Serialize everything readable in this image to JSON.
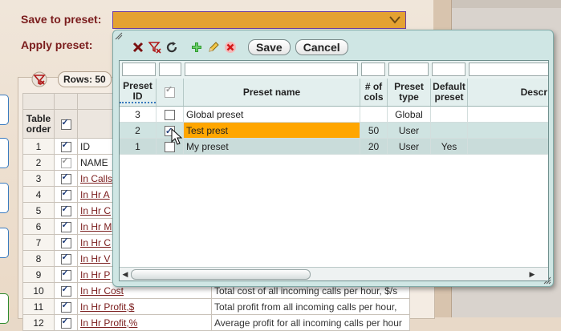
{
  "background": {
    "save_to_preset_label": "Save to preset:",
    "apply_preset_label": "Apply preset:",
    "rows_button_label": "Rows: 50",
    "table": {
      "header": {
        "order": "Table order"
      },
      "rows": [
        {
          "order": "1",
          "checked": true,
          "name": "ID",
          "link": false,
          "desc": ""
        },
        {
          "order": "2",
          "checked": true,
          "disabled": true,
          "name": "NAME",
          "link": false,
          "desc": ""
        },
        {
          "order": "3",
          "checked": true,
          "name": "In Calls",
          "link": true,
          "desc": ""
        },
        {
          "order": "4",
          "checked": true,
          "name": "In Hr A",
          "link": true,
          "desc": ""
        },
        {
          "order": "5",
          "checked": true,
          "name": "In Hr C",
          "link": true,
          "desc": ""
        },
        {
          "order": "6",
          "checked": true,
          "name": "In Hr M",
          "link": true,
          "desc": ""
        },
        {
          "order": "7",
          "checked": true,
          "name": "In Hr C",
          "link": true,
          "desc": ""
        },
        {
          "order": "8",
          "checked": true,
          "name": "In Hr V",
          "link": true,
          "desc": ""
        },
        {
          "order": "9",
          "checked": true,
          "name": "In Hr P",
          "link": true,
          "desc": ""
        },
        {
          "order": "10",
          "checked": true,
          "name": "In Hr Cost",
          "link": true,
          "desc": "Total cost of all incoming calls per hour, $/s"
        },
        {
          "order": "11",
          "checked": true,
          "name": "In Hr Profit,$",
          "link": true,
          "desc": "Total profit from all incoming calls per hour,"
        },
        {
          "order": "12",
          "checked": true,
          "name": "In Hr Profit,%",
          "link": true,
          "desc": "Average profit for all incoming calls per hour"
        }
      ]
    }
  },
  "dialog": {
    "toolbar": {
      "save_label": "Save",
      "cancel_label": "Cancel"
    },
    "columns": {
      "preset_id": "Preset ID",
      "preset_name": "Preset name",
      "num_cols": "# of cols",
      "preset_type": "Preset type",
      "default_preset": "Default preset",
      "description": "Descr"
    },
    "rows": [
      {
        "id": "3",
        "checked": false,
        "name": "Global preset",
        "cols": "",
        "type": "Global",
        "default": ""
      },
      {
        "id": "2",
        "checked": true,
        "name": "Test prest",
        "cols": "50",
        "type": "User",
        "default": ""
      },
      {
        "id": "1",
        "checked": false,
        "name": "My preset",
        "cols": "20",
        "type": "User",
        "default": "Yes"
      }
    ]
  },
  "colors": {
    "accent_orange": "#ffa600",
    "select_bg": "#e4a232",
    "dialog_bg": "#cfe6e4",
    "label_dark_red": "#7a1c1c"
  }
}
